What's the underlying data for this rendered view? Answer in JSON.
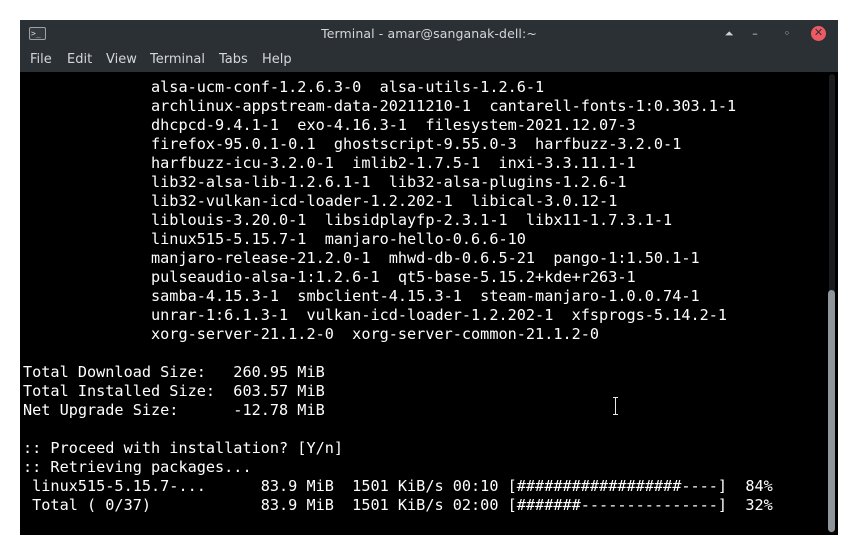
{
  "window": {
    "title": "Terminal - amar@sanganak-dell:~",
    "app_icon": "terminal-icon",
    "controls": [
      {
        "name": "keep-above-icon",
        "glyph": "⏶"
      },
      {
        "name": "minimize-icon",
        "glyph": "–"
      },
      {
        "name": "maximize-icon",
        "glyph": "◦"
      },
      {
        "name": "close-icon",
        "glyph": "✕"
      }
    ],
    "close_color": "#ee5a64"
  },
  "menubar": {
    "items": [
      "File",
      "Edit",
      "View",
      "Terminal",
      "Tabs",
      "Help"
    ]
  },
  "terminal": {
    "lines": [
      "              alsa-ucm-conf-1.2.6.3-0  alsa-utils-1.2.6-1",
      "              archlinux-appstream-data-20211210-1  cantarell-fonts-1:0.303.1-1",
      "              dhcpcd-9.4.1-1  exo-4.16.3-1  filesystem-2021.12.07-3",
      "              firefox-95.0.1-0.1  ghostscript-9.55.0-3  harfbuzz-3.2.0-1",
      "              harfbuzz-icu-3.2.0-1  imlib2-1.7.5-1  inxi-3.3.11.1-1",
      "              lib32-alsa-lib-1.2.6.1-1  lib32-alsa-plugins-1.2.6-1",
      "              lib32-vulkan-icd-loader-1.2.202-1  libical-3.0.12-1",
      "              liblouis-3.20.0-1  libsidplayfp-2.3.1-1  libx11-1.7.3.1-1",
      "              linux515-5.15.7-1  manjaro-hello-0.6.6-10",
      "              manjaro-release-21.2.0-1  mhwd-db-0.6.5-21  pango-1:1.50.1-1",
      "              pulseaudio-alsa-1:1.2.6-1  qt5-base-5.15.2+kde+r263-1",
      "              samba-4.15.3-1  smbclient-4.15.3-1  steam-manjaro-1.0.0.74-1",
      "              unrar-1:6.1.3-1  vulkan-icd-loader-1.2.202-1  xfsprogs-5.14.2-1",
      "              xorg-server-21.1.2-0  xorg-server-common-21.1.2-0",
      "",
      "Total Download Size:   260.95 MiB",
      "Total Installed Size:  603.57 MiB",
      "Net Upgrade Size:      -12.78 MiB",
      "",
      ":: Proceed with installation? [Y/n]",
      ":: Retrieving packages...",
      " linux515-5.15.7-...      83.9 MiB  1501 KiB/s 00:10 [##################----]  84%",
      " Total ( 0/37)            83.9 MiB  1501 KiB/s 02:00 [#######---------------]  32%"
    ],
    "progress": {
      "package": {
        "name": "linux515-5.15.7-...",
        "percent": 84
      },
      "total": {
        "name": "Total ( 0/37)",
        "percent": 32
      }
    },
    "scroll_position": 0.52,
    "pointer": "text-cursor-icon"
  }
}
